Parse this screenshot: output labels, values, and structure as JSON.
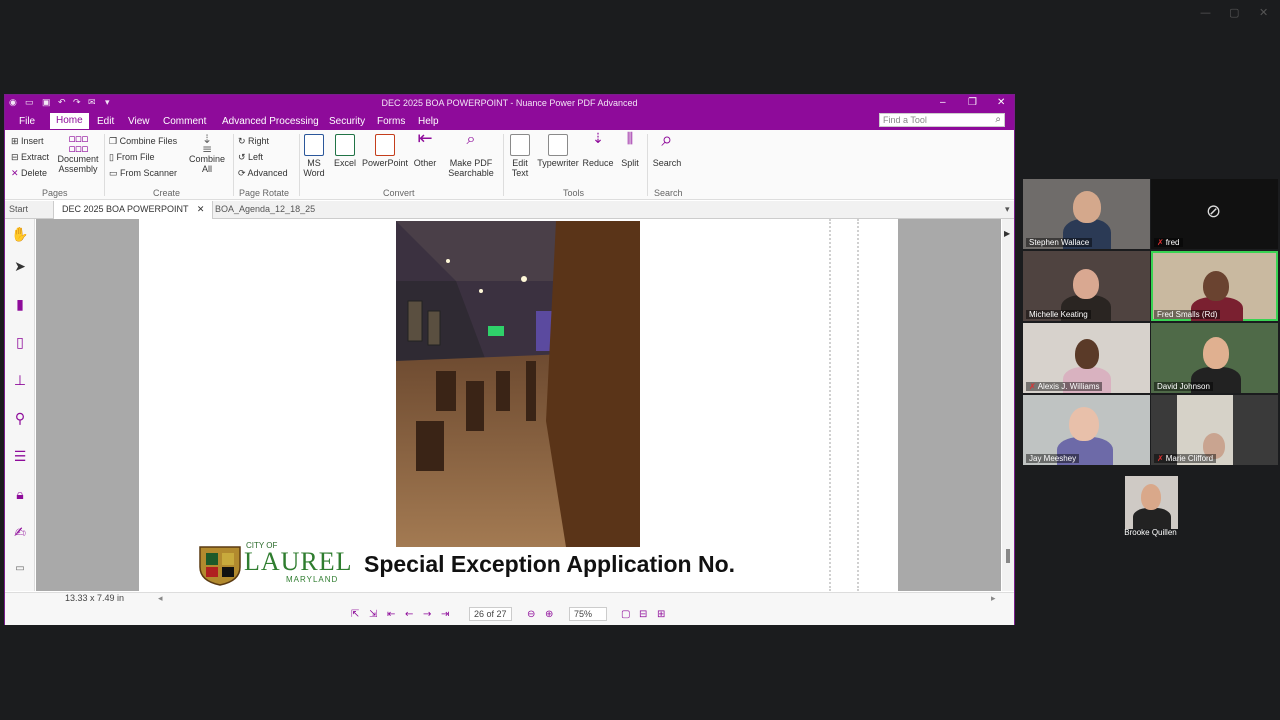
{
  "window": {
    "title": "DEC 2025 BOA POWERPOINT - Nuance Power PDF Advanced",
    "find_placeholder": "Find a Tool"
  },
  "menu": [
    "File",
    "Home",
    "Edit",
    "View",
    "Comment",
    "Advanced Processing",
    "Security",
    "Forms",
    "Help"
  ],
  "ribbon": {
    "pages": {
      "insert": "Insert",
      "extract": "Extract",
      "delete": "Delete",
      "doc_assembly_1": "Document",
      "doc_assembly_2": "Assembly",
      "group": "Pages"
    },
    "create": {
      "combine_files": "Combine Files",
      "from_file": "From File",
      "from_scanner": "From Scanner",
      "combine_all_1": "Combine",
      "combine_all_2": "All",
      "group": "Create"
    },
    "rotate": {
      "right": "Right",
      "left": "Left",
      "advanced": "Advanced",
      "group": "Page Rotate"
    },
    "convert": {
      "ms_word_1": "MS",
      "ms_word_2": "Word",
      "excel": "Excel",
      "powerpoint": "PowerPoint",
      "other": "Other",
      "searchable_1": "Make PDF",
      "searchable_2": "Searchable",
      "group": "Convert"
    },
    "tools": {
      "edit_text_1": "Edit",
      "edit_text_2": "Text",
      "typewriter": "Typewriter",
      "reduce": "Reduce",
      "split": "Split",
      "group": "Tools"
    },
    "search": {
      "search": "Search",
      "group": "Search"
    }
  },
  "tabs": {
    "start": "Start",
    "active": "DEC 2025 BOA POWERPOINT",
    "other": "BOA_Agenda_12_18_25"
  },
  "slide": {
    "logo_city": "CITY OF",
    "logo_name": "LAUREL",
    "logo_state": "MARYLAND",
    "title": "Special Exception Application No."
  },
  "status": {
    "page_size": "13.33 x 7.49 in",
    "page_indicator": "26 of 27",
    "zoom": "75%"
  },
  "participants": [
    {
      "name": "Stephen Wallace",
      "muted": false,
      "speaking": false
    },
    {
      "name": "fred",
      "muted": true,
      "speaking": false
    },
    {
      "name": "Michelle Keating",
      "muted": false,
      "speaking": false
    },
    {
      "name": "Fred Smalls (Rd)",
      "muted": false,
      "speaking": true
    },
    {
      "name": "Alexis J. Williams",
      "muted": true,
      "speaking": false
    },
    {
      "name": "David Johnson",
      "muted": false,
      "speaking": false
    },
    {
      "name": "Jay Meeshey",
      "muted": false,
      "speaking": false
    },
    {
      "name": "Marie Clifford",
      "muted": true,
      "speaking": false
    },
    {
      "name": "Brooke Quillen",
      "muted": false,
      "speaking": false
    }
  ],
  "colors": {
    "accent": "#8e0b9a",
    "speaking_outline": "#39d353",
    "background": "#1b1c1e"
  }
}
